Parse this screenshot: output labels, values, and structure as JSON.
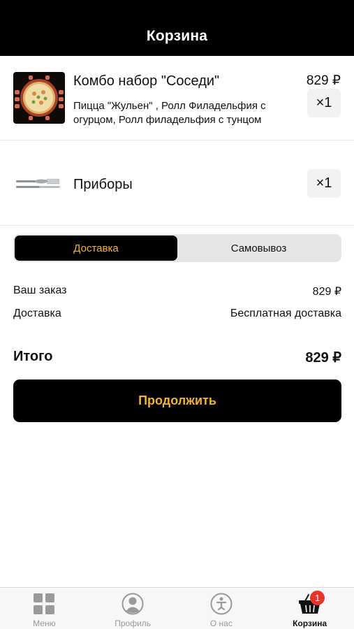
{
  "header": {
    "title": "Корзина"
  },
  "cart": {
    "items": [
      {
        "name": "Комбо набор \"Соседи\"",
        "description": "Пицца \"Жульен\" , Ролл Филадельфия с огурцом, Ролл филадельфия с тунцом",
        "price": "829 ₽",
        "quantity": "×1"
      },
      {
        "name": "Приборы",
        "quantity": "×1"
      }
    ]
  },
  "delivery_toggle": {
    "options": [
      "Доставка",
      "Самовывоз"
    ],
    "selected": "Доставка"
  },
  "summary": {
    "order_label": "Ваш заказ",
    "order_value": "829 ₽",
    "delivery_label": "Доставка",
    "delivery_value": "Бесплатная доставка",
    "total_label": "Итого",
    "total_value": "829 ₽"
  },
  "continue_button": "Продолжить",
  "colors": {
    "accent": "#f2b233",
    "primary": "#000000",
    "badge": "#e8342b"
  },
  "tabbar": {
    "tabs": [
      {
        "label": "Меню",
        "icon": "grid-icon"
      },
      {
        "label": "Профиль",
        "icon": "profile-icon"
      },
      {
        "label": "О нас",
        "icon": "info-icon"
      },
      {
        "label": "Корзина",
        "icon": "basket-icon",
        "badge": "1",
        "active": true
      }
    ]
  }
}
